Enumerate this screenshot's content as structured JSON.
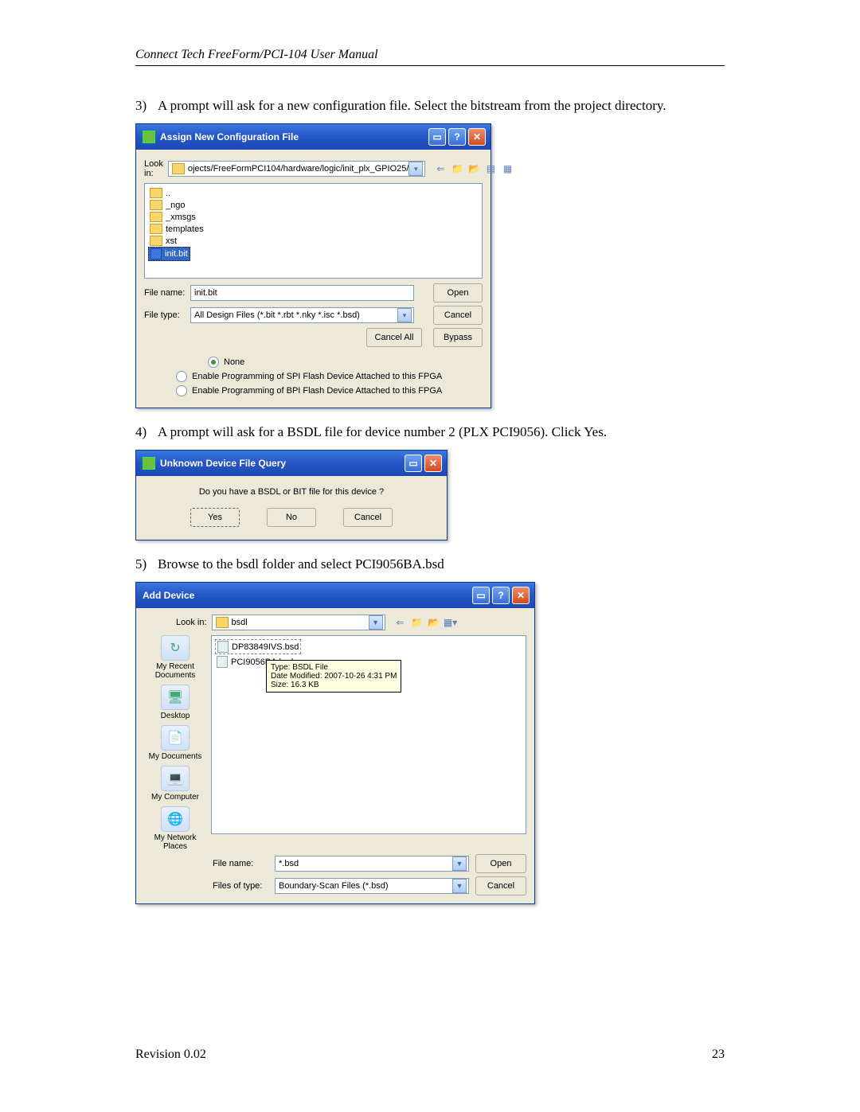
{
  "doc": {
    "header": "Connect Tech FreeForm/PCI-104 User Manual",
    "step3_num": "3)",
    "step3_text": "A prompt will ask for a new configuration file.  Select the bitstream from the project directory.",
    "step4_num": "4)",
    "step4_text": "A prompt will ask for a BSDL file for device number 2 (PLX PCI9056).  Click Yes.",
    "step5_num": "5)",
    "step5_text": "Browse to the bsdl folder and select PCI9056BA.bsd",
    "revision": "Revision 0.02",
    "page_number": "23"
  },
  "dlg1": {
    "title": "Assign New Configuration File",
    "lookin_label": "Look in:",
    "lookin_value": "ojects/FreeFormPCI104/hardware/logic/init_plx_GPIO25/",
    "files": {
      "up": "..",
      "ngo": "_ngo",
      "xmsgs": "_xmsgs",
      "templates": "templates",
      "xst": "xst",
      "initbit": "init.bit"
    },
    "filename_label": "File name:",
    "filename_value": "init.bit",
    "filetype_label": "File type:",
    "filetype_value": "All Design Files (*.bit *.rbt *.nky *.isc *.bsd)",
    "buttons": {
      "open": "Open",
      "cancel": "Cancel",
      "cancel_all": "Cancel All",
      "bypass": "Bypass"
    },
    "radios": {
      "none": "None",
      "spi": "Enable Programming of SPI Flash Device Attached to this FPGA",
      "bpi": "Enable Programming of BPI Flash Device Attached to this FPGA"
    }
  },
  "dlg2": {
    "title": "Unknown Device File Query",
    "message": "Do you have a BSDL or BIT file for this device ?",
    "yes": "Yes",
    "no": "No",
    "cancel": "Cancel"
  },
  "dlg3": {
    "title": "Add Device",
    "lookin_label": "Look in:",
    "lookin_value": "bsdl",
    "files": {
      "dp": "DP83849IVS.bsd",
      "pci": "PCI9056BA.bsd"
    },
    "tooltip": {
      "l1": "Type: BSDL File",
      "l2": "Date Modified: 2007-10-26 4:31 PM",
      "l3": "Size: 16.3 KB"
    },
    "places": {
      "recent": "My Recent Documents",
      "desktop": "Desktop",
      "mydocs": "My Documents",
      "mycomp": "My Computer",
      "mynet": "My Network Places"
    },
    "filename_label": "File name:",
    "filename_value": "*.bsd",
    "filetype_label": "Files of type:",
    "filetype_value": "Boundary-Scan Files (*.bsd)",
    "open": "Open",
    "cancel": "Cancel"
  }
}
